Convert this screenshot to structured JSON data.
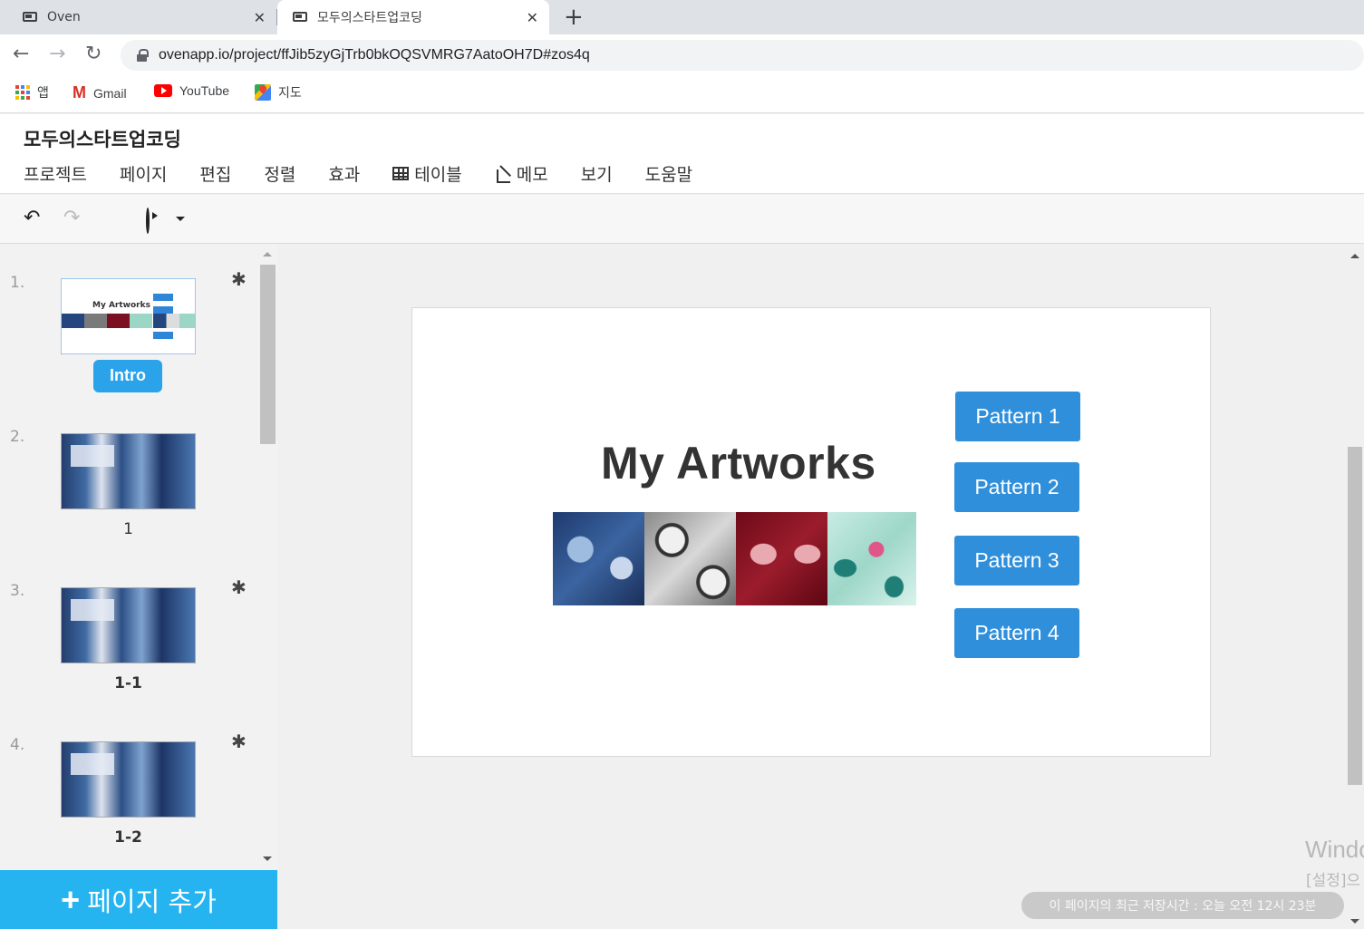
{
  "browser": {
    "tabs": [
      {
        "title": "Oven",
        "active": false
      },
      {
        "title": "모두의스타트업코딩",
        "active": true
      }
    ],
    "url": "ovenapp.io/project/ffJib5zyGjTrb0bkOQSVMRG7AatoOH7D#zos4q",
    "bookmarks": [
      {
        "label": "앱",
        "icon": "apps-icon"
      },
      {
        "label": "Gmail",
        "icon": "gmail-icon"
      },
      {
        "label": "YouTube",
        "icon": "youtube-icon"
      },
      {
        "label": "지도",
        "icon": "maps-icon"
      }
    ]
  },
  "app": {
    "project_title": "모두의스타트업코딩",
    "menu": [
      {
        "label": "프로젝트"
      },
      {
        "label": "페이지"
      },
      {
        "label": "편집"
      },
      {
        "label": "정렬"
      },
      {
        "label": "효과"
      },
      {
        "label": "테이블",
        "icon": "table-icon"
      },
      {
        "label": "메모",
        "icon": "memo-icon"
      },
      {
        "label": "보기"
      },
      {
        "label": "도움말"
      }
    ],
    "toolbar": {
      "undo_icon": "undo-icon",
      "redo_icon": "redo-icon",
      "save_icon": "save-icon",
      "play_icon": "play-icon",
      "dropdown_icon": "caret-down-icon"
    }
  },
  "sidebar": {
    "slides": [
      {
        "number": "1.",
        "label": "Intro",
        "active": true,
        "asterisk": "✱",
        "thumb_title": "My Artworks"
      },
      {
        "number": "2.",
        "label": "1",
        "active": false,
        "asterisk": ""
      },
      {
        "number": "3.",
        "label": "1-1",
        "active": false,
        "asterisk": "✱"
      },
      {
        "number": "4.",
        "label": "1-2",
        "active": false,
        "asterisk": "✱"
      }
    ],
    "add_page_label": "페이지 추가",
    "add_page_icon": "+"
  },
  "canvas": {
    "title": "My Artworks",
    "buttons": [
      "Pattern 1",
      "Pattern 2",
      "Pattern 3",
      "Pattern 4"
    ]
  },
  "overlay": {
    "windows_watermark_line1": "Windo",
    "windows_watermark_line2": "[설정]으",
    "save_status": "이 페이지의 최근 저장시간 : 오늘 오전 12시 23분"
  },
  "colors": {
    "accent": "#2ba3ea",
    "add_page_bg": "#25b4f0",
    "pattern_button": "#2f8fdb"
  }
}
